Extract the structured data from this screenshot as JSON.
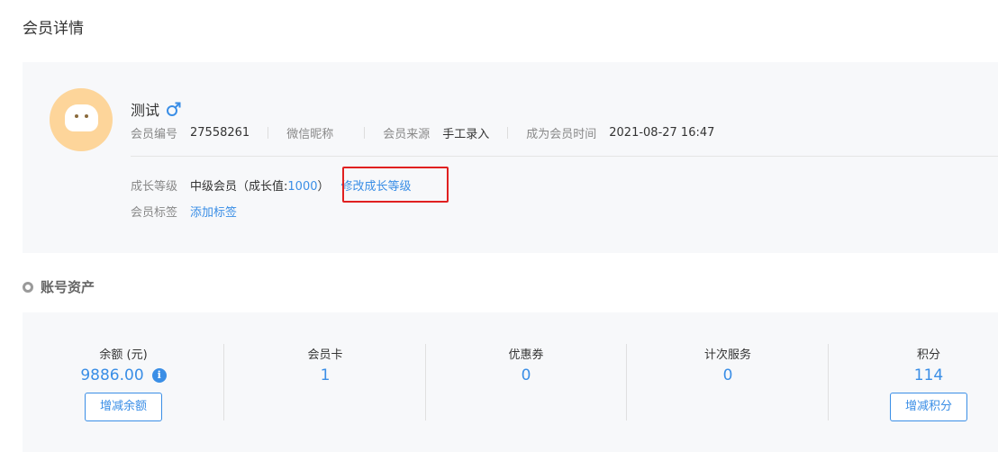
{
  "page": {
    "title": "会员详情"
  },
  "member": {
    "name": "测试",
    "gender_icon": "male-icon",
    "info": [
      {
        "label": "会员编号",
        "value": "27558261"
      },
      {
        "label": "微信昵称",
        "value": ""
      },
      {
        "label": "会员来源",
        "value": "手工录入"
      },
      {
        "label": "成为会员时间",
        "value": "2021-08-27 16:47"
      }
    ],
    "growth": {
      "label": "成长等级",
      "level_text": "中级会员（成长值:",
      "growth_value": "1000",
      "close_paren": "）",
      "modify_link": "修改成长等级"
    },
    "tags": {
      "label": "会员标签",
      "add_link": "添加标签"
    }
  },
  "assets": {
    "section_title": "账号资产",
    "items": [
      {
        "label": "余额 (元)",
        "value": "9886.00",
        "button": "增减余额"
      },
      {
        "label": "会员卡",
        "value": "1"
      },
      {
        "label": "优惠券",
        "value": "0"
      },
      {
        "label": "计次服务",
        "value": "0"
      },
      {
        "label": "积分",
        "value": "114",
        "button": "增减积分"
      }
    ]
  },
  "colors": {
    "accent": "#3a8ee6",
    "highlight": "#e02020",
    "panel_bg": "#f7f8fa",
    "avatar_bg": "#fdd59a"
  }
}
